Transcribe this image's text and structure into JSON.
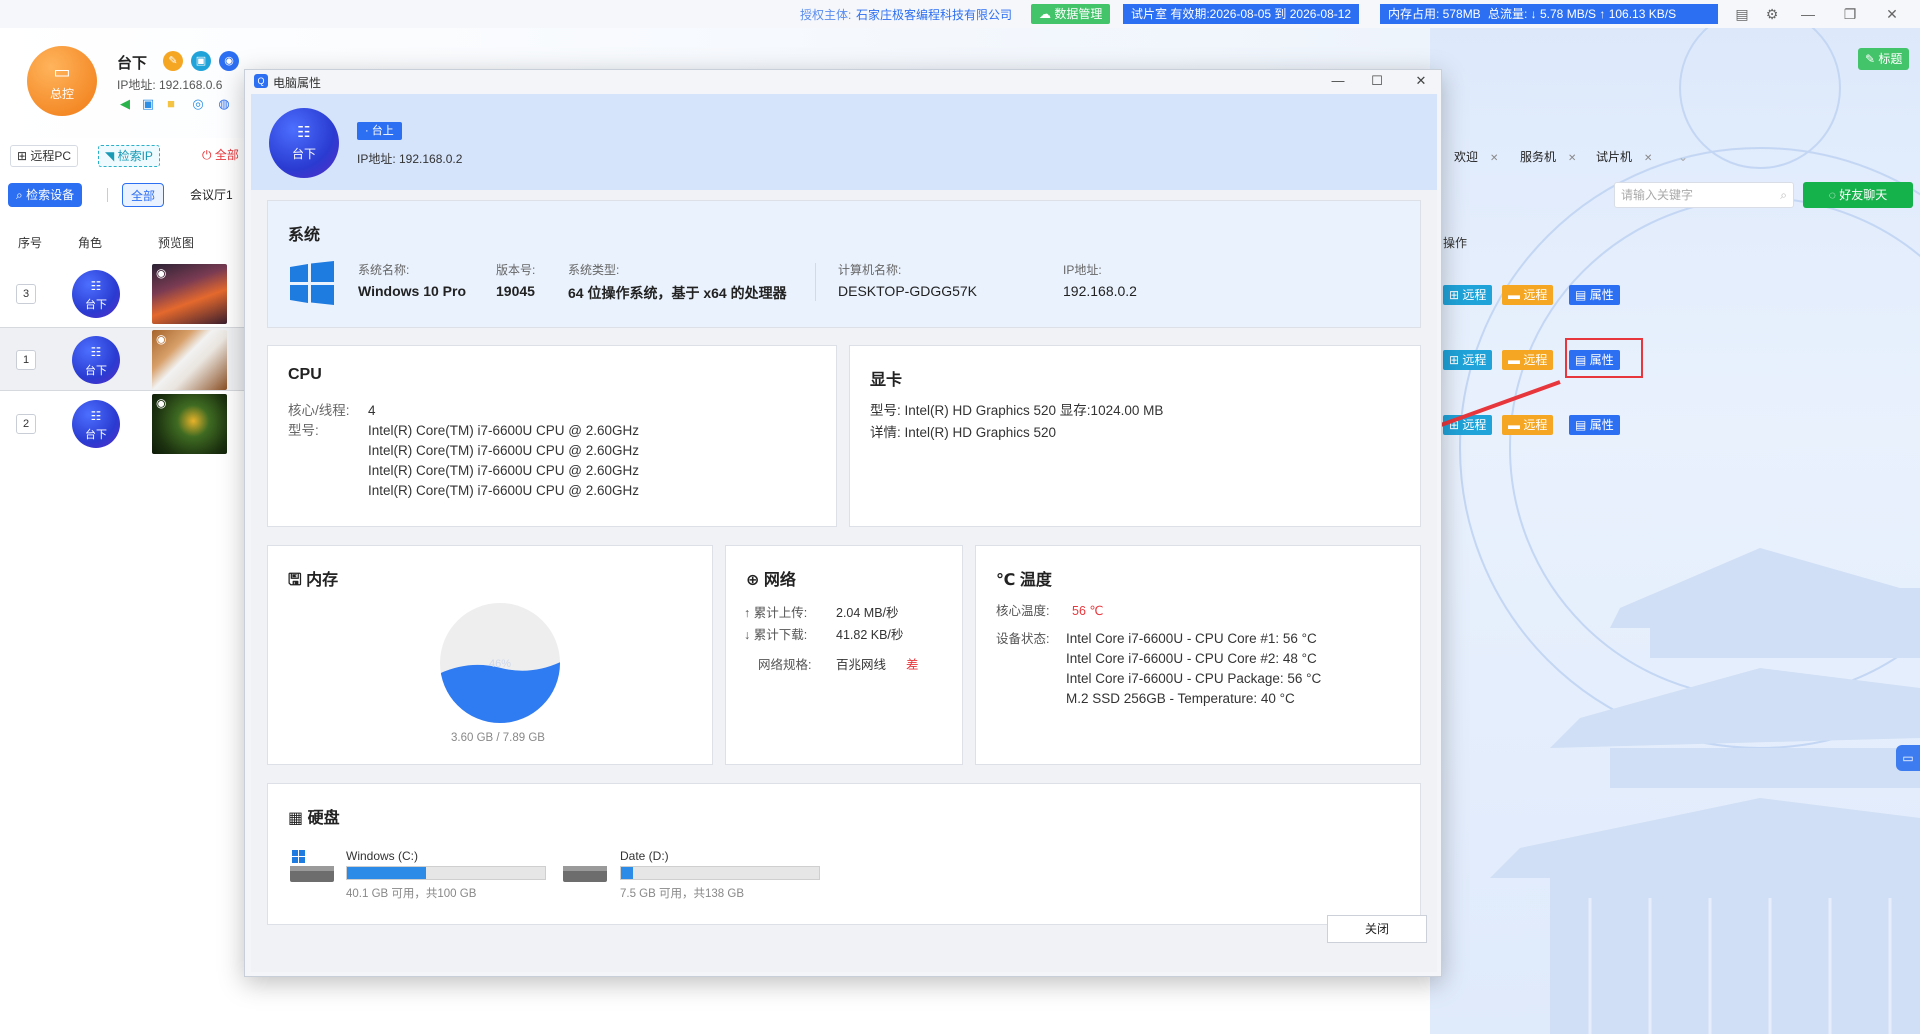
{
  "topbar": {
    "auth_label": "授权主体:",
    "auth_company": "石家庄极客编程科技有限公司",
    "data_mgmt": "数据管理",
    "room_validity": "试片室 有效期:2026-08-05 到 2026-08-12",
    "memory": "内存占用:   578MB",
    "traffic": "总流量:  ↓ 5.78 MB/S     ↑ 106.13 KB/S"
  },
  "header": {
    "logo_label": "总控",
    "title": "台下",
    "ip": "IP地址: 192.168.0.6"
  },
  "toolbar": {
    "remote_pc": "远程PC",
    "search_ip": "检索IP",
    "all_power": "全部"
  },
  "filter": {
    "search_device": "检索设备",
    "all": "全部",
    "room": "会议厅1"
  },
  "table": {
    "headers": {
      "index": "序号",
      "role": "角色",
      "preview": "预览图",
      "ops": "操作"
    },
    "rows": [
      {
        "index": "3",
        "role": "台下"
      },
      {
        "index": "1",
        "role": "台下"
      },
      {
        "index": "2",
        "role": "台下"
      }
    ],
    "op_labels": {
      "remote1": "远程",
      "remote2": "远程",
      "props": "属性"
    }
  },
  "right_panel": {
    "tabs": [
      "欢迎",
      "服务机",
      "试片机"
    ],
    "search_placeholder": "请输入关键字",
    "chat_button": "好友聊天",
    "label_button": "标题"
  },
  "dialog": {
    "title": "电脑属性",
    "avatar_label": "台下",
    "status_tag": "台上",
    "ip": "IP地址: 192.168.0.2",
    "system": {
      "title": "系统",
      "os_name_label": "系统名称:",
      "os_name": "Windows 10 Pro",
      "version_label": "版本号:",
      "version": "19045",
      "type_label": "系统类型:",
      "type": "64 位操作系统，基于 x64 的处理器",
      "computer_label": "计算机名称:",
      "computer": "DESKTOP-GDGG57K",
      "ip_label": "IP地址:",
      "ip": "192.168.0.2"
    },
    "cpu": {
      "title": "CPU",
      "cores_label": "核心/线程:",
      "cores": "4",
      "model_label": "型号:",
      "models": [
        "Intel(R) Core(TM) i7-6600U CPU @ 2.60GHz",
        "Intel(R) Core(TM) i7-6600U CPU @ 2.60GHz",
        "Intel(R) Core(TM) i7-6600U CPU @ 2.60GHz",
        "Intel(R) Core(TM) i7-6600U CPU @ 2.60GHz"
      ]
    },
    "gpu": {
      "title": "显卡",
      "model_line": "型号: Intel(R) HD Graphics 520 显存:1024.00 MB",
      "detail_line": "详情: Intel(R) HD Graphics 520"
    },
    "memory": {
      "title": "内存",
      "percent_label": "46%",
      "used_fraction": 0.46,
      "summary": "3.60 GB / 7.89 GB"
    },
    "network": {
      "title": "网络",
      "upload_label": "↑ 累计上传:",
      "upload": "2.04 MB/秒",
      "download_label": "↓ 累计下载:",
      "download": "41.82 KB/秒",
      "spec_label": "网络规格:",
      "spec": "百兆网线",
      "quality": "差"
    },
    "temperature": {
      "title": "℃ 温度",
      "core_label": "核心温度:",
      "core": "56 ℃",
      "device_label": "设备状态:",
      "devices": [
        "Intel Core i7-6600U - CPU Core #1: 56 °C",
        "Intel Core i7-6600U - CPU Core #2: 48 °C",
        "Intel Core i7-6600U - CPU Package: 56 °C",
        "M.2 SSD 256GB - Temperature: 40 °C"
      ]
    },
    "disk": {
      "title": "硬盘",
      "drives": [
        {
          "name": "Windows (C:)",
          "used_fraction": 0.4,
          "info": "40.1 GB 可用，共100 GB"
        },
        {
          "name": "Date (D:)",
          "used_fraction": 0.06,
          "info": "7.5 GB 可用，共138 GB"
        }
      ]
    },
    "close_button": "关闭"
  },
  "colors": {
    "brand_blue": "#2d6ff2",
    "green": "#15b14a",
    "orange": "#f5a623",
    "red": "#e8373c",
    "bar_blue": "#2b8be6"
  }
}
